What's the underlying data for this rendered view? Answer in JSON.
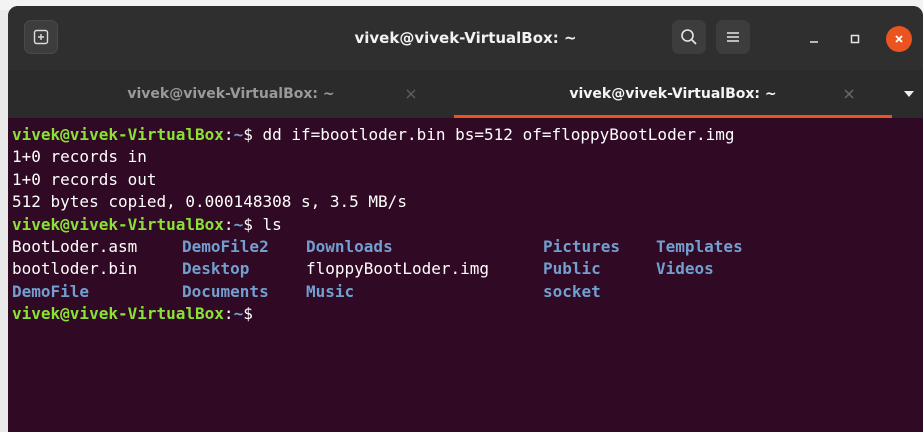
{
  "window": {
    "title": "vivek@vivek-VirtualBox: ~"
  },
  "tabs": [
    {
      "label": "vivek@vivek-VirtualBox: ~",
      "active": false
    },
    {
      "label": "vivek@vivek-VirtualBox: ~",
      "active": true
    }
  ],
  "terminal": {
    "prompt_user": "vivek@vivek-VirtualBox",
    "prompt_path": "~",
    "prompt_symbol": "$",
    "commands": [
      "dd if=bootloder.bin bs=512 of=floppyBootLoder.img",
      "ls"
    ],
    "output_lines": [
      "1+0 records in",
      "1+0 records out",
      "512 bytes copied, 0.000148308 s, 3.5 MB/s"
    ],
    "ls_rows": [
      [
        {
          "name": "BootLoder.asm",
          "kind": "file"
        },
        {
          "name": "DemoFile2",
          "kind": "dir"
        },
        {
          "name": "Downloads",
          "kind": "dir"
        },
        {
          "name": "Pictures",
          "kind": "dir"
        },
        {
          "name": "Templates",
          "kind": "dir"
        }
      ],
      [
        {
          "name": "bootloder.bin",
          "kind": "file"
        },
        {
          "name": "Desktop",
          "kind": "dir"
        },
        {
          "name": "floppyBootLoder.img",
          "kind": "file"
        },
        {
          "name": "Public",
          "kind": "dir"
        },
        {
          "name": "Videos",
          "kind": "dir"
        }
      ],
      [
        {
          "name": "DemoFile",
          "kind": "dir"
        },
        {
          "name": "Documents",
          "kind": "dir"
        },
        {
          "name": "Music",
          "kind": "dir"
        },
        {
          "name": "socket",
          "kind": "dir"
        },
        {
          "name": "",
          "kind": "file"
        }
      ]
    ]
  },
  "colors": {
    "terminal_bg": "#300a24",
    "prompt_user": "#8ae234",
    "directory": "#729fcf",
    "accent": "#e95420"
  }
}
